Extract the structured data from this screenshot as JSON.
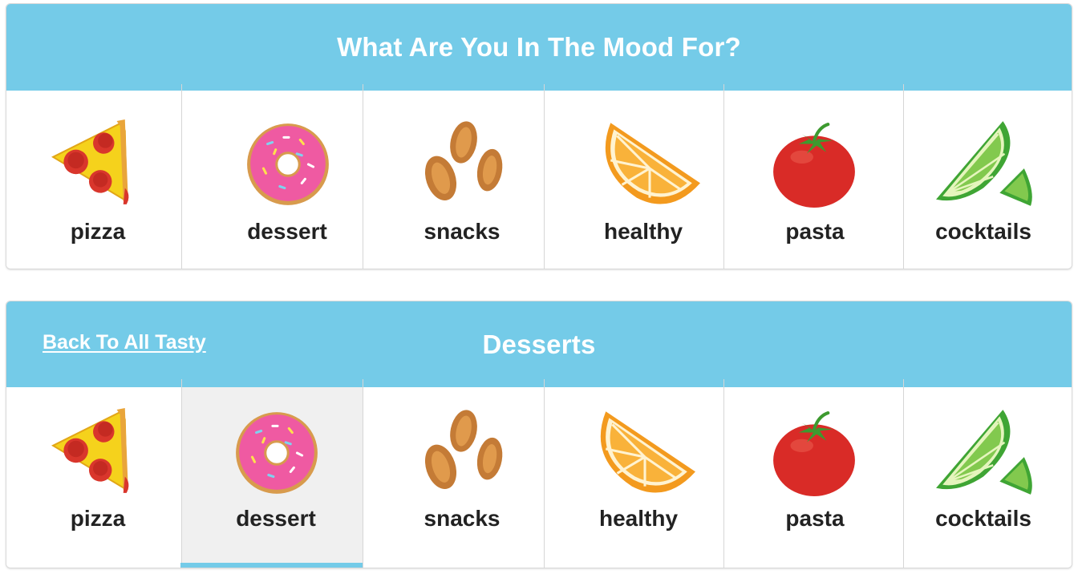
{
  "mood_panel": {
    "title": "What Are You In The Mood For?"
  },
  "desserts_panel": {
    "back_link": "Back To All Tasty",
    "title": "Desserts",
    "active_category": "dessert"
  },
  "categories": [
    {
      "label": "pizza",
      "icon": "pizza-slice-icon"
    },
    {
      "label": "dessert",
      "icon": "donut-icon"
    },
    {
      "label": "snacks",
      "icon": "almonds-icon"
    },
    {
      "label": "healthy",
      "icon": "orange-slice-icon"
    },
    {
      "label": "pasta",
      "icon": "tomato-icon"
    },
    {
      "label": "cocktails",
      "icon": "lime-wedge-icon"
    }
  ],
  "colors": {
    "header": "#74cbe8",
    "active_cell": "#f0f0f0",
    "active_underline": "#74cbe8"
  }
}
